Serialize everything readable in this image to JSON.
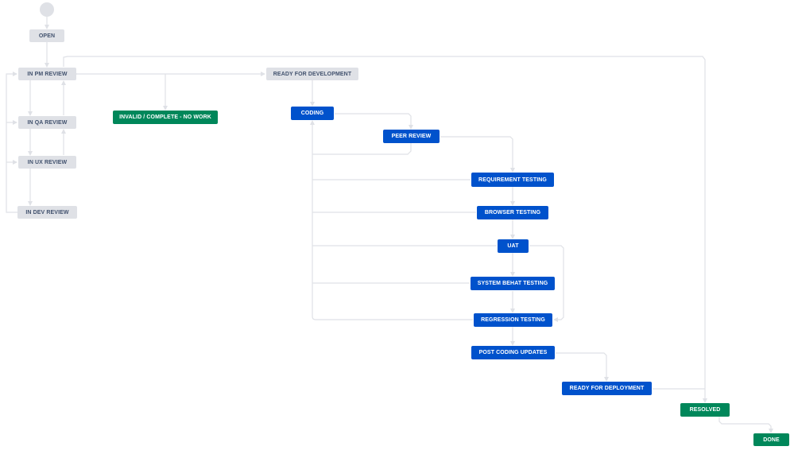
{
  "workflow": {
    "start": "start-circle",
    "nodes": {
      "open": {
        "label": "OPEN",
        "category": "todo"
      },
      "in_pm_review": {
        "label": "IN PM REVIEW",
        "category": "todo"
      },
      "in_qa_review": {
        "label": "IN QA REVIEW",
        "category": "todo"
      },
      "in_ux_review": {
        "label": "IN UX REVIEW",
        "category": "todo"
      },
      "in_dev_review": {
        "label": "IN DEV REVIEW",
        "category": "todo"
      },
      "ready_for_development": {
        "label": "READY FOR DEVELOPMENT",
        "category": "todo"
      },
      "invalid_complete": {
        "label": "INVALID / COMPLETE - NO WORK",
        "category": "done"
      },
      "coding": {
        "label": "CODING",
        "category": "in-progress"
      },
      "peer_review": {
        "label": "PEER REVIEW",
        "category": "in-progress"
      },
      "requirement_testing": {
        "label": "REQUIREMENT TESTING",
        "category": "in-progress"
      },
      "browser_testing": {
        "label": "BROWSER TESTING",
        "category": "in-progress"
      },
      "uat": {
        "label": "UAT",
        "category": "in-progress"
      },
      "system_behat_testing": {
        "label": "SYSTEM BEHAT TESTING",
        "category": "in-progress"
      },
      "regression_testing": {
        "label": "REGRESSION TESTING",
        "category": "in-progress"
      },
      "post_coding_updates": {
        "label": "POST CODING UPDATES",
        "category": "in-progress"
      },
      "ready_for_deployment": {
        "label": "READY FOR DEPLOYMENT",
        "category": "in-progress"
      },
      "resolved": {
        "label": "RESOLVED",
        "category": "done"
      },
      "done": {
        "label": "DONE",
        "category": "done"
      }
    }
  },
  "colors": {
    "todo": "#dfe1e6",
    "in_progress": "#0052cc",
    "done": "#00875a",
    "connector": "#dfe1e6"
  }
}
